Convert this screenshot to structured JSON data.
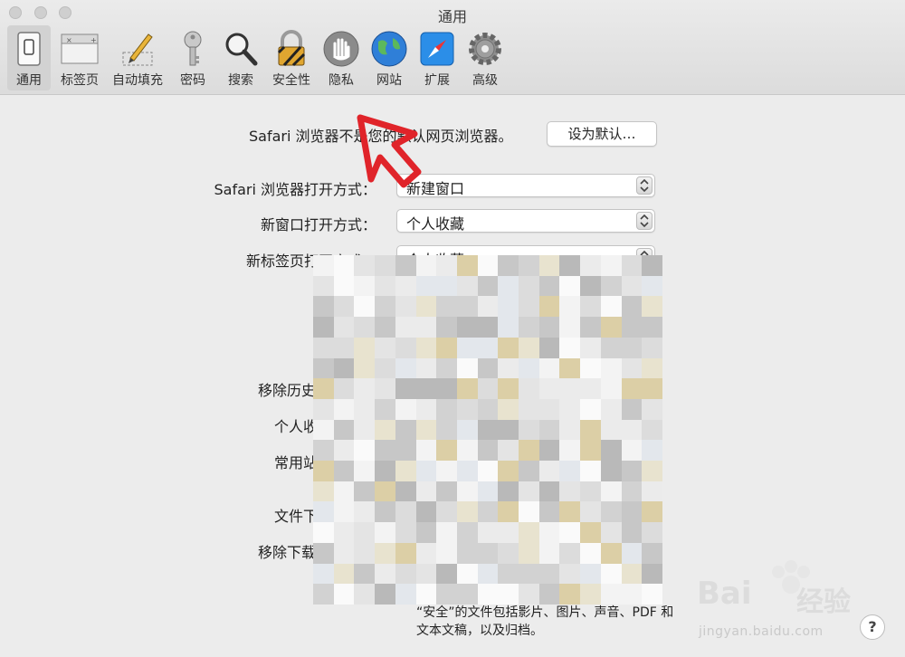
{
  "window": {
    "title": "通用"
  },
  "toolbar": {
    "items": [
      {
        "id": "general",
        "label": "通用",
        "icon": "general-switch-icon"
      },
      {
        "id": "tabs",
        "label": "标签页",
        "icon": "tabs-icon"
      },
      {
        "id": "autofill",
        "label": "自动填充",
        "icon": "pencil-icon"
      },
      {
        "id": "passwords",
        "label": "密码",
        "icon": "key-icon"
      },
      {
        "id": "search",
        "label": "搜索",
        "icon": "magnifier-icon"
      },
      {
        "id": "security",
        "label": "安全性",
        "icon": "padlock-icon"
      },
      {
        "id": "privacy",
        "label": "隐私",
        "icon": "hand-icon"
      },
      {
        "id": "websites",
        "label": "网站",
        "icon": "globe-icon"
      },
      {
        "id": "extensions",
        "label": "扩展",
        "icon": "compass-icon"
      },
      {
        "id": "advanced",
        "label": "高级",
        "icon": "gear-icon"
      }
    ],
    "selected": "通用"
  },
  "general": {
    "default_browser_text": "Safari 浏览器不是您的默认网页浏览器。",
    "set_default_button": "设为默认…",
    "open_with_label": "Safari 浏览器打开方式：",
    "open_with_value": "新建窗口",
    "new_window_label": "新窗口打开方式：",
    "new_window_value": "个人收藏",
    "new_tab_label": "新标签页打开方式：",
    "new_tab_value": "个人收藏",
    "remove_history_label": "移除历史",
    "favorites_label": "个人收",
    "frequently_label": "常用站",
    "downloads_label": "文件下",
    "remove_downloads_label": "移除下载",
    "safe_files_note_line1": "“安全”的文件包括影片、图片、声音、PDF 和",
    "safe_files_note_line2": "文本文稿，以及归档。"
  },
  "help": {
    "label": "?"
  },
  "watermark": {
    "brand": "Bai",
    "brand_cn": "经验",
    "url": "jingyan.baidu.com"
  }
}
